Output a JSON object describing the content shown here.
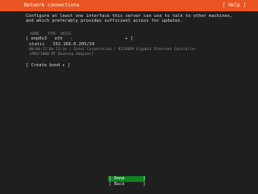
{
  "header": {
    "title": "Network connections",
    "help": "[ Help ]"
  },
  "intro": {
    "line1": "Configure at least one interface this server can use to talk to other machines,",
    "line2": "and which preferably provides sufficient access for updates."
  },
  "table": {
    "headers": "NAME    TYPE  NOTES",
    "interface": {
      "text": "[ enp0s3   eth   -                    ▸ ]"
    },
    "address": {
      "text": "static   192.168.0.205/24"
    },
    "description": {
      "line1": "08:00:27:0e:12:4e / Intel Corporation / 82540EM Gigabit Ethernet Controller",
      "line2": "(PRO/1000 MT Desktop Adapter)"
    }
  },
  "actions": {
    "create_bond": "[ Create bond ▸ ]"
  },
  "buttons": {
    "done": "[ Done       ]",
    "back": "[ Back       ]"
  },
  "colors": {
    "accent": "#e95420",
    "done_bg": "#0e8420",
    "background": "#1f1f1f"
  }
}
